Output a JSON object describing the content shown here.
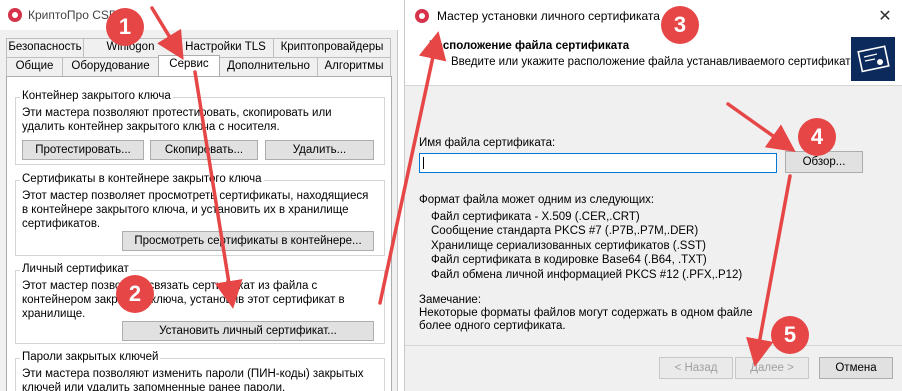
{
  "left_window": {
    "title": "КриптоПро CSP",
    "tabs_row1": [
      "Безопасность",
      "Winlogon",
      "Настройки TLS",
      "Криптопровайдеры"
    ],
    "tabs_row2": [
      "Общие",
      "Оборудование",
      "Сервис",
      "Дополнительно",
      "Алгоритмы"
    ],
    "active_tab": "Сервис",
    "groups": [
      {
        "title": "Контейнер закрытого ключа",
        "text": [
          "Эти мастера позволяют протестировать, скопировать или",
          "удалить контейнер закрытого ключа с носителя."
        ],
        "buttons": [
          "Протестировать...",
          "Скопировать...",
          "Удалить..."
        ]
      },
      {
        "title": "Сертификаты в контейнере закрытого ключа",
        "text": [
          "Этот мастер позволяет просмотреть сертификаты, находящиеся",
          "в контейнере закрытого ключа, и установить их в хранилище",
          "сертификатов."
        ],
        "buttons": [
          "Просмотреть сертификаты в контейнере..."
        ]
      },
      {
        "title": "Личный сертификат",
        "text": [
          "Этот мастер позволяет связать сертификат из файла с",
          "контейнером закрытого ключа, установив этот сертификат в",
          "хранилище."
        ],
        "buttons": [
          "Установить личный сертификат..."
        ]
      },
      {
        "title": "Пароли закрытых ключей",
        "text": [
          "Эти мастера позволяют изменить пароли (ПИН-коды) закрытых",
          "ключей или удалить запомненные ранее пароли."
        ],
        "buttons": []
      }
    ]
  },
  "right_window": {
    "title": "Мастер установки личного сертификата",
    "header_title": "Расположение файла сертификата",
    "header_subtitle": "Введите или укажите расположение файла устанавливаемого сертификата",
    "filename_label": "Имя файла сертификата:",
    "filename_value": "",
    "browse_button": "Обзор...",
    "formats_label": "Формат файла может одним из следующих:",
    "formats": [
      "Файл сертификата - X.509 (.CER,.CRT)",
      "Сообщение стандарта PKCS #7 (.P7B,.P7M,.DER)",
      "Хранилище сериализованных сертификатов (.SST)",
      "Файл сертификата в кодировке Base64 (.B64, .TXT)",
      "Файл обмена личной информацией PKCS #12 (.PFX,.P12)"
    ],
    "note_label": "Замечание:",
    "note_text": [
      "Некоторые форматы файлов могут содержать в одном файле",
      "более одного сертификата."
    ],
    "back_button": "< Назад",
    "next_button": "Далее >",
    "cancel_button": "Отмена",
    "close_glyph": "✕"
  },
  "markers": [
    "1",
    "2",
    "3",
    "4",
    "5"
  ],
  "colors": {
    "marker": "#e64646",
    "arrow": "#e64646",
    "input_focus": "#0078d7",
    "logo": "#0d2a5c"
  }
}
